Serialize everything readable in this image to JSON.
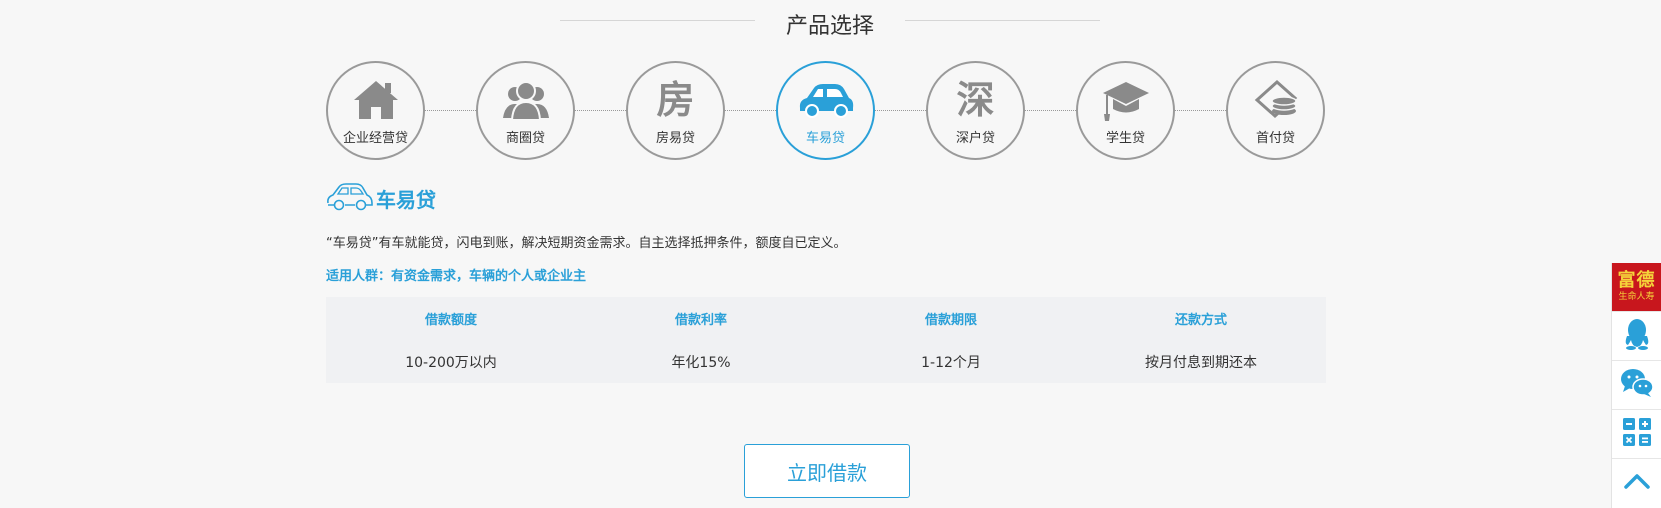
{
  "section": {
    "title": "产品选择"
  },
  "products": [
    {
      "key": "enterprise",
      "label": "企业经营贷",
      "icon": "house-icon",
      "glyph": ""
    },
    {
      "key": "business-circle",
      "label": "商圈贷",
      "icon": "people-icon",
      "glyph": ""
    },
    {
      "key": "house",
      "label": "房易贷",
      "icon": "house-char-icon",
      "glyph": "房"
    },
    {
      "key": "car",
      "label": "车易贷",
      "icon": "car-icon",
      "glyph": "",
      "active": true
    },
    {
      "key": "shenzhen-hukou",
      "label": "深户贷",
      "icon": "shen-char-icon",
      "glyph": "深"
    },
    {
      "key": "student",
      "label": "学生贷",
      "icon": "graduation-cap-icon",
      "glyph": ""
    },
    {
      "key": "down-payment",
      "label": "首付贷",
      "icon": "coins-icon",
      "glyph": ""
    }
  ],
  "detail": {
    "name": "车易贷",
    "description": "“车易贷”有车就能贷，闪电到账，解决短期资金需求。自主选择抵押条件，额度自已定义。",
    "audience": "适用人群：有资金需求，车辆的个人或企业主",
    "terms_headers": [
      "借款额度",
      "借款利率",
      "借款期限",
      "还款方式"
    ],
    "terms_values": [
      "10-200万以内",
      "年化15%",
      "1-12个月",
      "按月付息到期还本"
    ]
  },
  "apply_button": "立即借款",
  "sidebar": {
    "brand_main": "富德",
    "brand_sub": "生命人寿",
    "tools": [
      "qq-icon",
      "wechat-icon",
      "calculator-icon",
      "back-to-top-icon"
    ]
  },
  "colors": {
    "accent": "#2aa0d8",
    "icon_gray": "#8a8a8a",
    "brand_red": "#c8161d",
    "brand_gold": "#f5d33a"
  }
}
